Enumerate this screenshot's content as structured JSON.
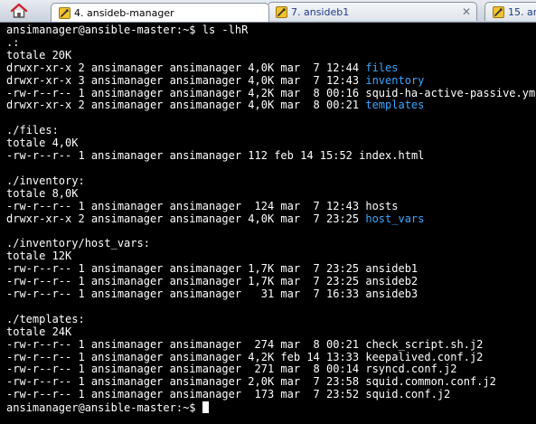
{
  "tabs": [
    {
      "label": "4. ansideb-manager",
      "state": "active"
    },
    {
      "label": "7. ansideb1",
      "state": "inactive"
    },
    {
      "label": "15. an",
      "state": "inactive"
    }
  ],
  "terminal": {
    "lines": [
      {
        "text": "ansimanager@ansible-master:~$ ls -lhR"
      },
      {
        "text": ".:"
      },
      {
        "text": "totale 20K"
      },
      {
        "prefix": "drwxr-xr-x 2 ansimanager ansimanager 4,0K mar  7 12:44 ",
        "name": "files",
        "kind": "dir"
      },
      {
        "prefix": "drwxr-xr-x 3 ansimanager ansimanager 4,0K mar  7 12:43 ",
        "name": "inventory",
        "kind": "dir"
      },
      {
        "prefix": "-rw-r--r-- 1 ansimanager ansimanager 4,2K mar  8 00:16 ",
        "name": "squid-ha-active-passive.yml",
        "kind": "file"
      },
      {
        "prefix": "drwxr-xr-x 2 ansimanager ansimanager 4,0K mar  8 00:21 ",
        "name": "templates",
        "kind": "dir"
      },
      {
        "text": ""
      },
      {
        "text": "./files:"
      },
      {
        "text": "totale 4,0K"
      },
      {
        "prefix": "-rw-r--r-- 1 ansimanager ansimanager 112 feb 14 15:52 ",
        "name": "index.html",
        "kind": "file"
      },
      {
        "text": ""
      },
      {
        "text": "./inventory:"
      },
      {
        "text": "totale 8,0K"
      },
      {
        "prefix": "-rw-r--r-- 1 ansimanager ansimanager  124 mar  7 12:43 ",
        "name": "hosts",
        "kind": "file"
      },
      {
        "prefix": "drwxr-xr-x 2 ansimanager ansimanager 4,0K mar  7 23:25 ",
        "name": "host_vars",
        "kind": "dir"
      },
      {
        "text": ""
      },
      {
        "text": "./inventory/host_vars:"
      },
      {
        "text": "totale 12K"
      },
      {
        "prefix": "-rw-r--r-- 1 ansimanager ansimanager 1,7K mar  7 23:25 ",
        "name": "ansideb1",
        "kind": "file"
      },
      {
        "prefix": "-rw-r--r-- 1 ansimanager ansimanager 1,7K mar  7 23:25 ",
        "name": "ansideb2",
        "kind": "file"
      },
      {
        "prefix": "-rw-r--r-- 1 ansimanager ansimanager   31 mar  7 16:33 ",
        "name": "ansideb3",
        "kind": "file"
      },
      {
        "text": ""
      },
      {
        "text": "./templates:"
      },
      {
        "text": "totale 24K"
      },
      {
        "prefix": "-rw-r--r-- 1 ansimanager ansimanager  274 mar  8 00:21 ",
        "name": "check_script.sh.j2",
        "kind": "file"
      },
      {
        "prefix": "-rw-r--r-- 1 ansimanager ansimanager 4,2K feb 14 13:33 ",
        "name": "keepalived.conf.j2",
        "kind": "file"
      },
      {
        "prefix": "-rw-r--r-- 1 ansimanager ansimanager  271 mar  8 00:14 ",
        "name": "rsyncd.conf.j2",
        "kind": "file"
      },
      {
        "prefix": "-rw-r--r-- 1 ansimanager ansimanager 2,0K mar  7 23:58 ",
        "name": "squid.common.conf.j2",
        "kind": "file"
      },
      {
        "prefix": "-rw-r--r-- 1 ansimanager ansimanager  173 mar  7 23:52 ",
        "name": "squid.conf.j2",
        "kind": "file"
      }
    ],
    "prompt": "ansimanager@ansible-master:~$ "
  },
  "colors": {
    "background": "#000000",
    "foreground": "#ffffff",
    "directory": "#3aa7ff"
  },
  "icons": {
    "home": "home-icon",
    "session": "terminal-session-icon",
    "close": "close-icon"
  }
}
